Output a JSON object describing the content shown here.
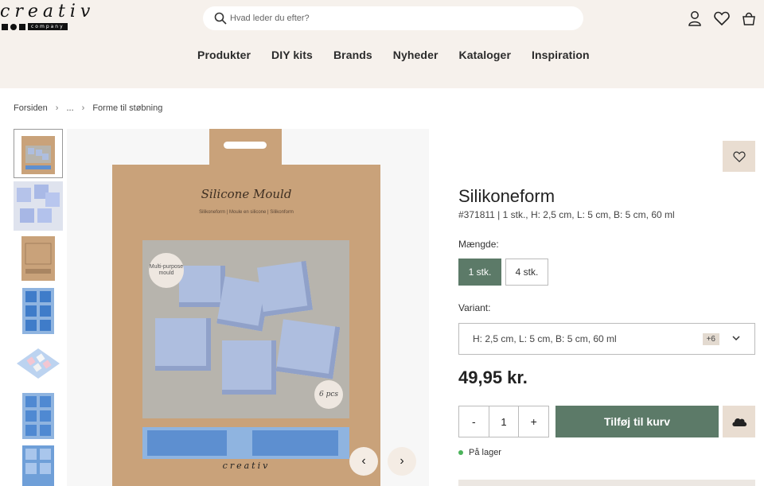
{
  "header": {
    "logo_word": "creativ",
    "logo_sub": "company",
    "search_placeholder": "Hvad leder du efter?",
    "nav": [
      "Produkter",
      "DIY kits",
      "Brands",
      "Nyheder",
      "Kataloger",
      "Inspiration"
    ]
  },
  "breadcrumb": [
    "Forsiden",
    "...",
    "Forme til støbning"
  ],
  "gallery": {
    "package_title": "Silicone Mould",
    "package_subtitle": "Silikoneform | Moule en silicone | Silikonform",
    "badge_left": "Multi-purpose mould",
    "badge_right": "6 pcs",
    "package_logo": "creativ",
    "prev_label": "‹",
    "next_label": "›"
  },
  "product": {
    "title": "Silikoneform",
    "meta": "#371811 | 1 stk., H: 2,5 cm, L: 5 cm, B: 5 cm, 60 ml",
    "qty_label": "Mængde:",
    "qty_options": [
      "1 stk.",
      "4 stk."
    ],
    "variant_label": "Variant:",
    "variant_value": "H: 2,5 cm, L: 5 cm, B: 5 cm, 60 ml",
    "variant_more": "+6",
    "price": "49,95 kr.",
    "quantity": "1",
    "minus": "-",
    "plus": "+",
    "add_to_cart": "Tilføj til kurv",
    "stock": "På lager"
  },
  "colors": {
    "accent_green": "#5c7a68",
    "header_bg": "#f6f1ec",
    "stock_green": "#4bb35a"
  }
}
